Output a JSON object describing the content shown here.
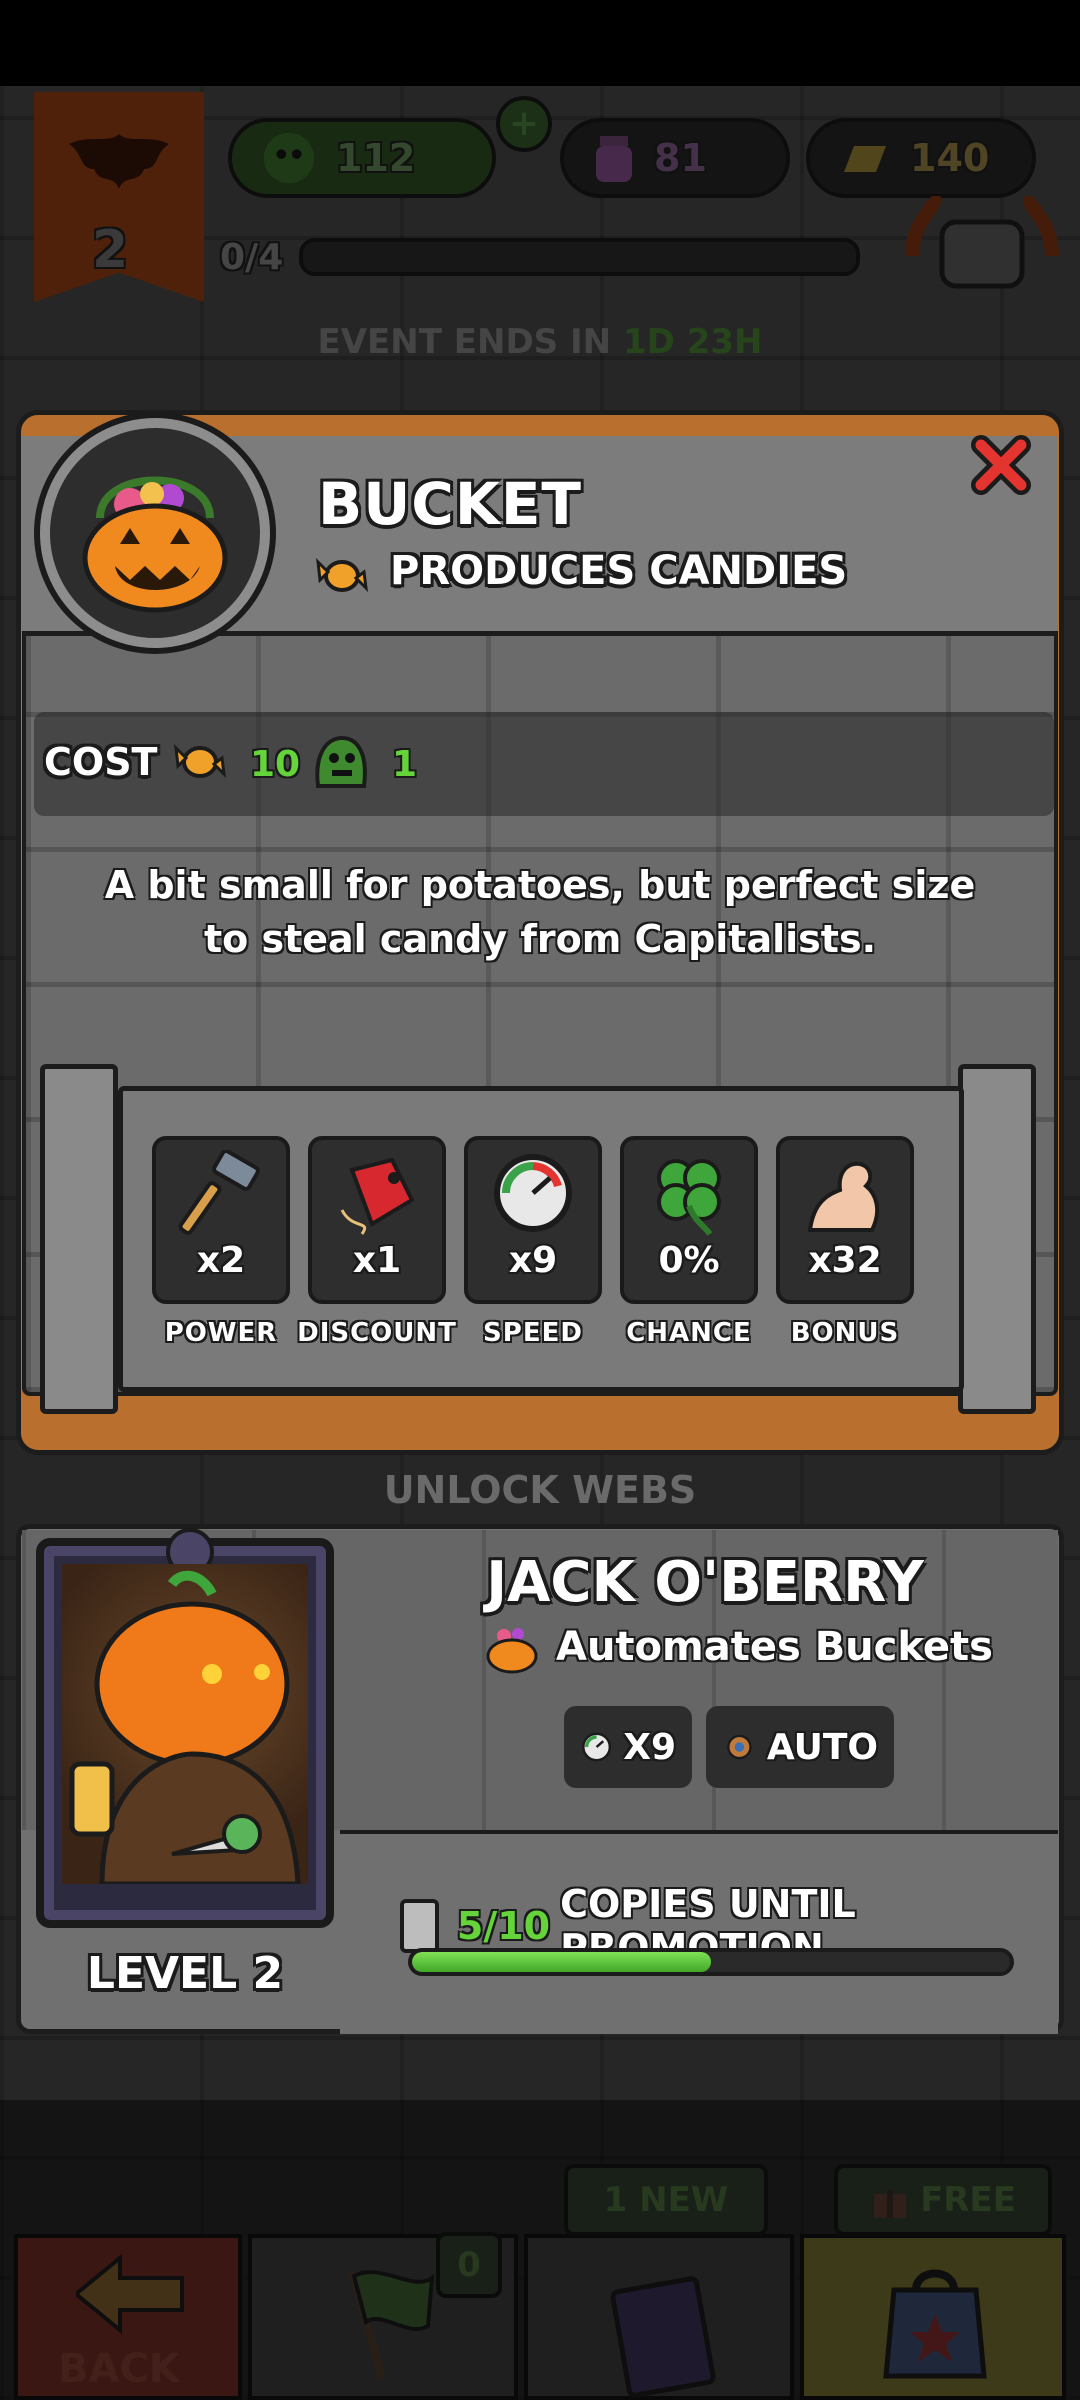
{
  "hud": {
    "banner_level": "2",
    "zombies_count": "112",
    "potion_count": "81",
    "gold_count": "140",
    "progress_text": "0/4",
    "event_ends_label": "EVENT ENDS IN",
    "event_ends_days": "1D",
    "event_ends_hours": "23H"
  },
  "item": {
    "title": "BUCKET",
    "subtitle": "PRODUCES CANDIES",
    "cost_label": "COST",
    "cost_candy": "10",
    "cost_zombies": "1",
    "description": "A bit small for potatoes, but perfect size to steal candy from Capitalists."
  },
  "stats": [
    {
      "icon": "hammer-icon",
      "value": "x2",
      "label": "POWER"
    },
    {
      "icon": "price-tag-icon",
      "value": "x1",
      "label": "DISCOUNT"
    },
    {
      "icon": "speedometer-icon",
      "value": "x9",
      "label": "SPEED"
    },
    {
      "icon": "four-leaf-clover-icon",
      "value": "0%",
      "label": "CHANCE"
    },
    {
      "icon": "flexed-arm-icon",
      "value": "x32",
      "label": "BONUS"
    }
  ],
  "unlock_webs": "UNLOCK WEBS",
  "worker": {
    "name": "JACK O'BERRY",
    "role": "Automates Buckets",
    "speed_chip": "X9",
    "auto_chip": "AUTO",
    "level": "LEVEL 2",
    "copies_count": "5/10",
    "copies_text": "COPIES UNTIL PROMOTION",
    "copies_progress": 0.5
  },
  "nav": {
    "back_label": "BACK",
    "flag_badge": "0",
    "cards_badge": "1 NEW",
    "shop_badge": "FREE"
  },
  "colors": {
    "accent_green": "#64d43a",
    "wood": "#b96f2e",
    "close_red": "#e3342f"
  }
}
